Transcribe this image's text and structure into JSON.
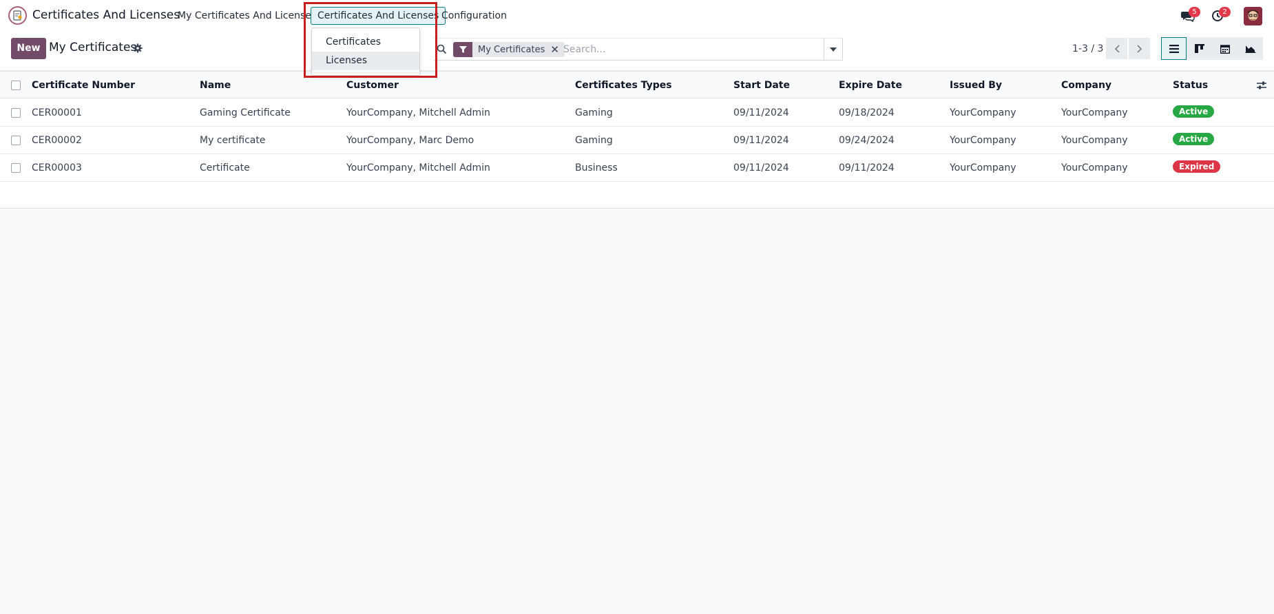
{
  "navbar": {
    "app_title": "Certificates And Licenses",
    "menu_my": "My Certificates And Licenses",
    "menu_certs": "Certificates And Licenses",
    "menu_config": "Configuration",
    "dropdown": [
      "Certificates",
      "Licenses"
    ],
    "messages_count": "5",
    "activities_count": "2"
  },
  "control": {
    "new_label": "New",
    "title": "My Certificates",
    "facet_label": "My Certificates",
    "facet_close": "✕",
    "search_placeholder": "Search...",
    "pager": "1-3 / 3"
  },
  "table": {
    "headers": [
      "Certificate Number",
      "Name",
      "Customer",
      "Certificates Types",
      "Start Date",
      "Expire Date",
      "Issued By",
      "Company",
      "Status"
    ],
    "rows": [
      [
        "CER00001",
        "Gaming Certificate",
        "YourCompany, Mitchell Admin",
        "Gaming",
        "09/11/2024",
        "09/18/2024",
        "YourCompany",
        "YourCompany",
        "Active"
      ],
      [
        "CER00002",
        "My certificate",
        "YourCompany, Marc Demo",
        "Gaming",
        "09/11/2024",
        "09/24/2024",
        "YourCompany",
        "YourCompany",
        "Active"
      ],
      [
        "CER00003",
        "Certificate",
        "YourCompany, Mitchell Admin",
        "Business",
        "09/11/2024",
        "09/11/2024",
        "YourCompany",
        "YourCompany",
        "Expired"
      ]
    ]
  },
  "colors": {
    "brand": "#714b67",
    "accent": "#017e84",
    "active": "#28a745",
    "expired": "#dc3545",
    "highlight": "#c81e1e"
  }
}
